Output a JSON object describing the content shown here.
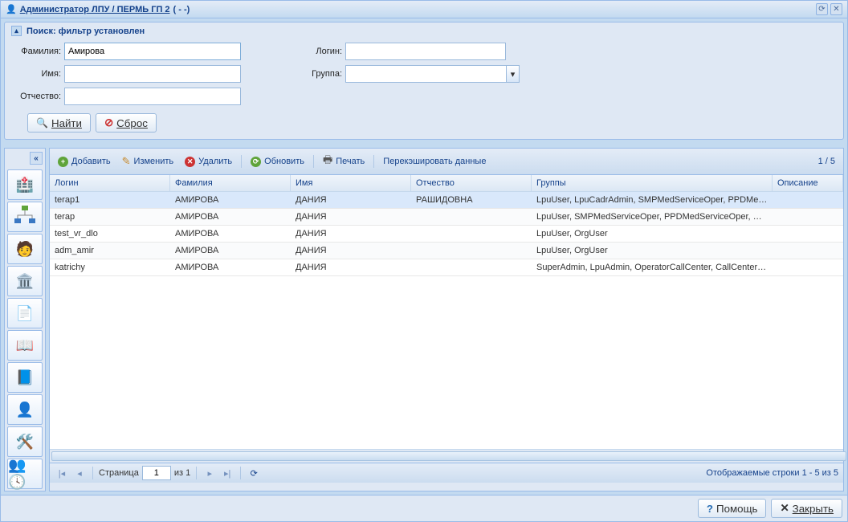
{
  "titlebar": {
    "title": "Администратор ЛПУ / ПЕРМЬ ГП 2",
    "suffix": "( - -)"
  },
  "search": {
    "header": "Поиск: фильтр установлен",
    "labels": {
      "family": "Фамилия:",
      "name": "Имя:",
      "patronymic": "Отчество:",
      "login": "Логин:",
      "group": "Группа:"
    },
    "family_value": "Амирова",
    "find_label": "Найти",
    "reset_label": "Сброс"
  },
  "toolbar": {
    "add": "Добавить",
    "edit": "Изменить",
    "delete": "Удалить",
    "refresh": "Обновить",
    "print": "Печать",
    "recache": "Перекэшировать данные",
    "counter": "1 / 5"
  },
  "columns": {
    "login": "Логин",
    "family": "Фамилия",
    "name": "Имя",
    "patronymic": "Отчество",
    "groups": "Группы",
    "desc": "Описание"
  },
  "rows": [
    {
      "login": "terap1",
      "family": "АМИРОВА",
      "name": "ДАНИЯ",
      "patronymic": "РАШИДОВНА",
      "groups": "LpuUser, LpuCadrAdmin, SMPMedServiceOper, PPDMedS...",
      "desc": ""
    },
    {
      "login": "terap",
      "family": "АМИРОВА",
      "name": "ДАНИЯ",
      "patronymic": "",
      "groups": "LpuUser, SMPMedServiceOper, PPDMedServiceOper, Org...",
      "desc": ""
    },
    {
      "login": "test_vr_dlo",
      "family": "АМИРОВА",
      "name": "ДАНИЯ",
      "patronymic": "",
      "groups": "LpuUser, OrgUser",
      "desc": ""
    },
    {
      "login": "adm_amir",
      "family": "АМИРОВА",
      "name": "ДАНИЯ",
      "patronymic": "",
      "groups": "LpuUser, OrgUser",
      "desc": ""
    },
    {
      "login": "katrichy",
      "family": "АМИРОВА",
      "name": "ДАНИЯ",
      "patronymic": "",
      "groups": "SuperAdmin, LpuAdmin, OperatorCallCenter, CallCenterAd...",
      "desc": ""
    }
  ],
  "pager": {
    "page_label": "Страница",
    "page_value": "1",
    "of_label": "из 1",
    "info": "Отображаемые строки 1 - 5 из 5"
  },
  "footer": {
    "help": "Помощь",
    "close": "Закрыть"
  }
}
